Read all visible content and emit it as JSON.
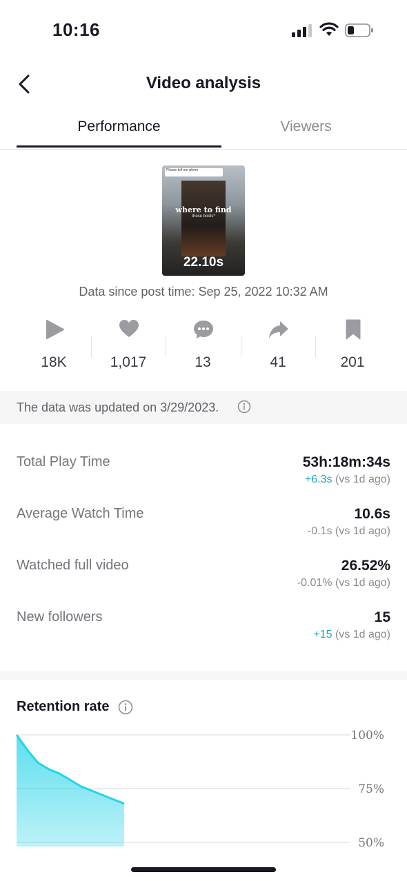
{
  "status_bar": {
    "time": "10:16"
  },
  "header": {
    "title": "Video analysis"
  },
  "tabs": [
    {
      "label": "Performance",
      "active": true
    },
    {
      "label": "Viewers",
      "active": false
    }
  ],
  "video": {
    "overlay_comment": "Please tell me where",
    "caption": "where to find",
    "caption_sub": "these boots*",
    "duration": "22.10s"
  },
  "data_since": "Data since post time: Sep 25, 2022 10:32 AM",
  "stats": [
    {
      "icon": "play-icon",
      "value": "18K"
    },
    {
      "icon": "heart-icon",
      "value": "1,017"
    },
    {
      "icon": "comment-icon",
      "value": "13"
    },
    {
      "icon": "share-icon",
      "value": "41"
    },
    {
      "icon": "bookmark-icon",
      "value": "201"
    }
  ],
  "updated_note": "The data was updated on 3/29/2023.",
  "metrics": [
    {
      "label": "Total Play Time",
      "value": "53h:18m:34s",
      "change": "+6.3s",
      "change_type": "positive",
      "compare": "(vs 1d ago)"
    },
    {
      "label": "Average Watch Time",
      "value": "10.6s",
      "change": "-0.1s",
      "change_type": "negative",
      "compare": "(vs 1d ago)"
    },
    {
      "label": "Watched full video",
      "value": "26.52%",
      "change": "-0.01%",
      "change_type": "negative",
      "compare": "(vs 1d ago)"
    },
    {
      "label": "New followers",
      "value": "15",
      "change": "+15",
      "change_type": "positive",
      "compare": "(vs 1d ago)"
    }
  ],
  "retention": {
    "title": "Retention rate"
  },
  "chart_data": {
    "type": "area",
    "title": "Retention rate",
    "y_tick_labels": [
      "100%",
      "75%",
      "50%"
    ],
    "ylim": [
      50,
      100
    ],
    "x": [
      0,
      1,
      2,
      3,
      4,
      5,
      6,
      7,
      8,
      9,
      10
    ],
    "values": [
      100,
      93,
      87,
      84,
      82,
      79,
      76,
      74,
      72,
      70,
      68
    ],
    "grid": true,
    "color": "#25d4e8"
  },
  "colors": {
    "accent": "#20a3bd",
    "chart": "#25d4e8",
    "text": "#161823"
  }
}
